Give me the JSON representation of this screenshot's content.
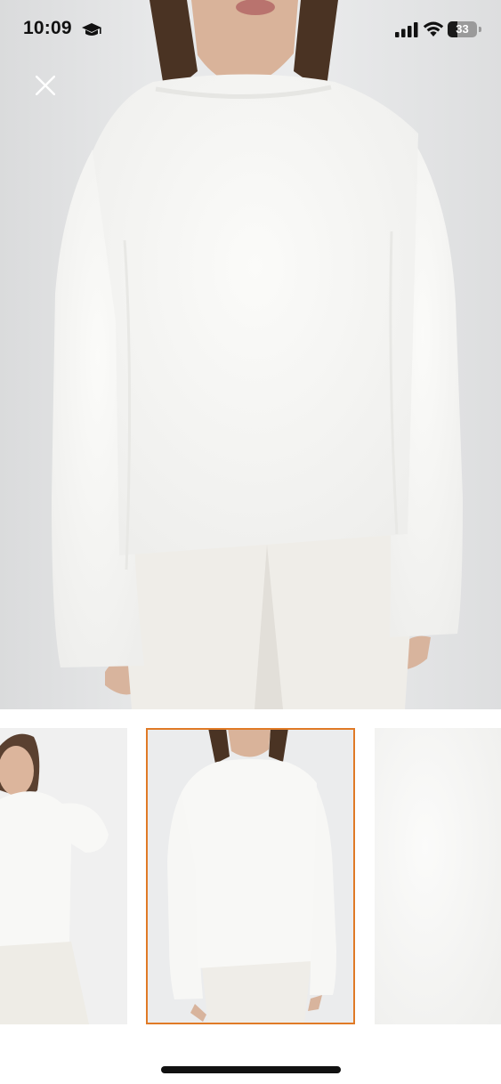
{
  "status_bar": {
    "time": "10:09",
    "battery_level": "33",
    "battery_fraction": 0.33,
    "icons": [
      "graduation-cap-icon",
      "cellular-signal-icon",
      "wifi-icon",
      "battery-icon"
    ]
  },
  "viewer": {
    "close_icon": "close-icon",
    "selected_thumbnail_index": 1,
    "thumbnail_count": 3
  },
  "colors": {
    "selected_border": "#e07a26",
    "sweater": "#f7f7f5",
    "background": "#ffffff"
  }
}
